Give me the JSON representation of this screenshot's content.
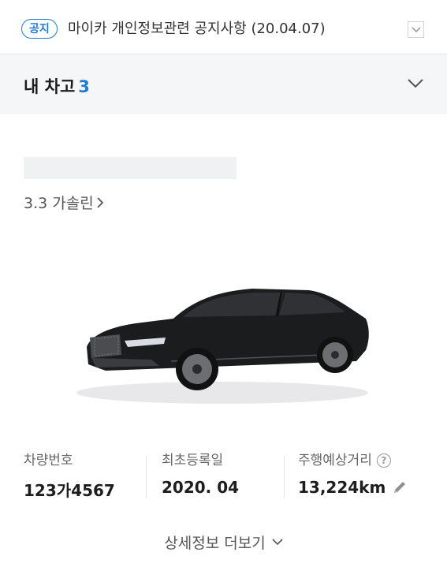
{
  "notice": {
    "badge": "공지",
    "text": "마이카 개인정보관련 공지사항 (20.04.07)"
  },
  "garage": {
    "title": "내 차고",
    "count": "3"
  },
  "car": {
    "trim": "3.3 가솔린"
  },
  "info": {
    "plate_label": "차량번호",
    "plate_value": "123가4567",
    "reg_label": "최초등록일",
    "reg_value": "2020. 04",
    "mileage_label": "주행예상거리",
    "mileage_value": "13,224km"
  },
  "more": {
    "label": "상세정보 더보기"
  },
  "colors": {
    "accent": "#1f7bd8",
    "car_body": "#1b1c1e"
  },
  "icons": [
    "chevron-down-icon",
    "chevron-right-icon",
    "help-icon",
    "pencil-icon",
    "car-image"
  ]
}
